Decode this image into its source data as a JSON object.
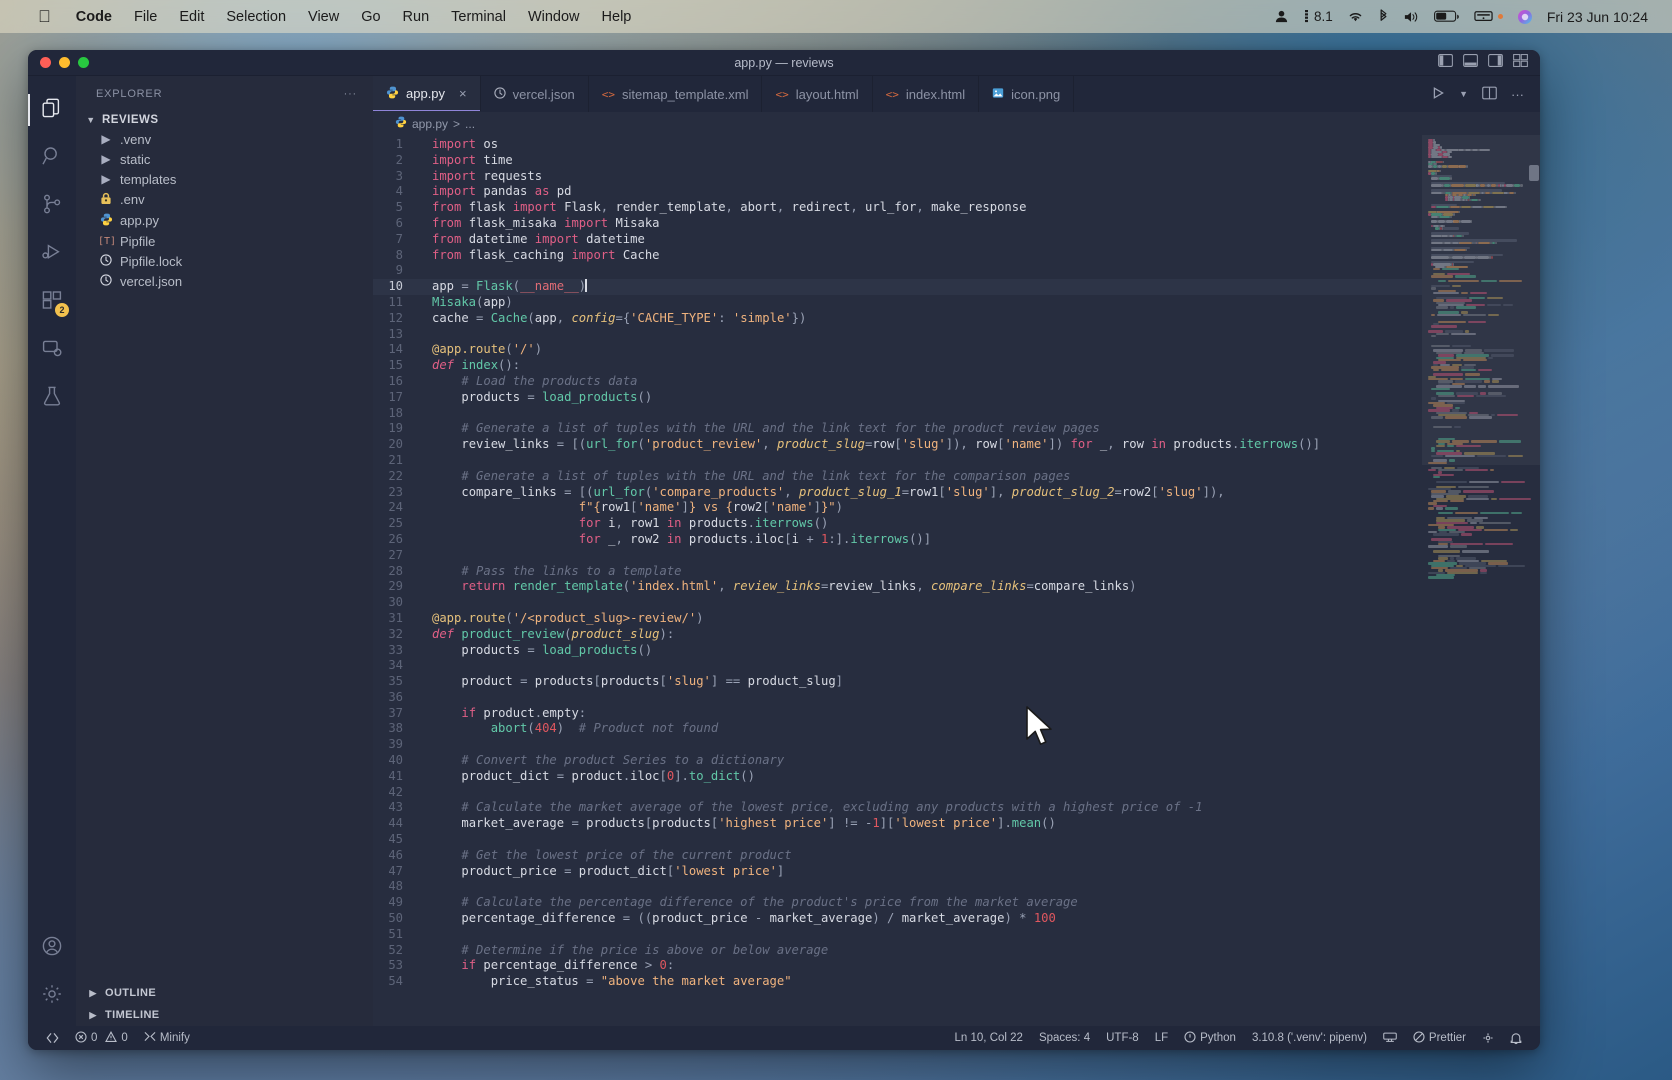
{
  "menubar": {
    "apple": "",
    "items": [
      "Code",
      "File",
      "Edit",
      "Selection",
      "View",
      "Go",
      "Run",
      "Terminal",
      "Window",
      "Help"
    ],
    "status_right": {
      "user_icon": "user-icon",
      "battery_percent": "8.1",
      "wifi_icon": "wifi-icon",
      "bluetooth_icon": "bluetooth-icon",
      "volume_icon": "volume-icon",
      "battery_icon": "battery-icon",
      "display_icon": "display-icon",
      "siri_icon": "siri-icon",
      "clock": "Fri 23 Jun 10:24"
    }
  },
  "window": {
    "title": "app.py — reviews",
    "traffic": [
      "close",
      "minimize",
      "zoom"
    ],
    "layout_buttons": [
      "toggle-primary-sidebar",
      "toggle-panel",
      "toggle-secondary-sidebar",
      "customize-layout"
    ]
  },
  "activitybar": {
    "items": [
      {
        "name": "explorer",
        "icon": "files-icon",
        "active": true,
        "badge": null
      },
      {
        "name": "search",
        "icon": "search-icon",
        "active": false,
        "badge": null
      },
      {
        "name": "source-control",
        "icon": "source-control-icon",
        "active": false,
        "badge": null
      },
      {
        "name": "run-and-debug",
        "icon": "debug-icon",
        "active": false,
        "badge": null
      },
      {
        "name": "extensions",
        "icon": "extensions-icon",
        "active": false,
        "badge": "2"
      },
      {
        "name": "remote-explorer",
        "icon": "remote-explorer-icon",
        "active": false,
        "badge": null
      },
      {
        "name": "testing",
        "icon": "beaker-icon",
        "active": false,
        "badge": null
      }
    ],
    "bottom": [
      {
        "name": "accounts",
        "icon": "account-icon"
      },
      {
        "name": "settings",
        "icon": "gear-icon"
      }
    ]
  },
  "sidebar": {
    "header": "EXPLORER",
    "more_actions": "···",
    "project": "REVIEWS",
    "files": [
      {
        "label": ".venv",
        "type": "folder",
        "icon": "folder-arrow"
      },
      {
        "label": "static",
        "type": "folder",
        "icon": "folder-arrow"
      },
      {
        "label": "templates",
        "type": "folder",
        "icon": "folder-arrow"
      },
      {
        "label": ".env",
        "type": "file",
        "icon": "lock-icon"
      },
      {
        "label": "app.py",
        "type": "file",
        "icon": "python-icon"
      },
      {
        "label": "Pipfile",
        "type": "file",
        "icon": "toml-icon"
      },
      {
        "label": "Pipfile.lock",
        "type": "file",
        "icon": "json-icon"
      },
      {
        "label": "vercel.json",
        "type": "file",
        "icon": "json-icon"
      }
    ],
    "footer": [
      {
        "label": "OUTLINE"
      },
      {
        "label": "TIMELINE"
      }
    ]
  },
  "tabs": [
    {
      "label": "app.py",
      "icon": "python-icon",
      "active": true,
      "close": "×"
    },
    {
      "label": "vercel.json",
      "icon": "json-icon",
      "active": false
    },
    {
      "label": "sitemap_template.xml",
      "icon": "code-icon",
      "active": false
    },
    {
      "label": "layout.html",
      "icon": "code-icon",
      "active": false
    },
    {
      "label": "index.html",
      "icon": "code-icon",
      "active": false
    },
    {
      "label": "icon.png",
      "icon": "image-icon",
      "active": false
    }
  ],
  "tab_actions": [
    "run-python-file",
    "chevron-down-icon",
    "split-editor-icon",
    "more-actions-icon"
  ],
  "breadcrumb": {
    "file": "app.py",
    "sep": ">",
    "rest": "..."
  },
  "editor": {
    "cursor_line": 10,
    "lines": [
      {
        "n": 1,
        "html": "<span class=\"kw\">import</span> <span class=\"var\">os</span>"
      },
      {
        "n": 2,
        "html": "<span class=\"kw\">import</span> <span class=\"var\">time</span>"
      },
      {
        "n": 3,
        "html": "<span class=\"kw\">import</span> <span class=\"var\">requests</span>"
      },
      {
        "n": 4,
        "html": "<span class=\"kw\">import</span> <span class=\"var\">pandas</span> <span class=\"kw\">as</span> <span class=\"var\">pd</span>"
      },
      {
        "n": 5,
        "html": "<span class=\"kw\">from</span> <span class=\"var\">flask</span> <span class=\"kw\">import</span> <span class=\"var\">Flask</span><span class=\"pun\">,</span> <span class=\"var\">render_template</span><span class=\"pun\">,</span> <span class=\"var\">abort</span><span class=\"pun\">,</span> <span class=\"var\">redirect</span><span class=\"pun\">,</span> <span class=\"var\">url_for</span><span class=\"pun\">,</span> <span class=\"var\">make_response</span>"
      },
      {
        "n": 6,
        "html": "<span class=\"kw\">from</span> <span class=\"var\">flask_misaka</span> <span class=\"kw\">import</span> <span class=\"var\">Misaka</span>"
      },
      {
        "n": 7,
        "html": "<span class=\"kw\">from</span> <span class=\"var\">datetime</span> <span class=\"kw\">import</span> <span class=\"var\">datetime</span>"
      },
      {
        "n": 8,
        "html": "<span class=\"kw\">from</span> <span class=\"var\">flask_caching</span> <span class=\"kw\">import</span> <span class=\"var\">Cache</span>"
      },
      {
        "n": 9,
        "html": ""
      },
      {
        "n": 10,
        "html": "<span class=\"var\">app</span> <span class=\"pun\">=</span> <span class=\"fn\">Flask</span><span class=\"pun\">(</span><span class=\"self\">__name__</span><span class=\"pun\">)</span><span class=\"caret\"></span>"
      },
      {
        "n": 11,
        "html": "<span class=\"fn\">Misaka</span><span class=\"pun\">(</span><span class=\"var\">app</span><span class=\"pun\">)</span>"
      },
      {
        "n": 12,
        "html": "<span class=\"var\">cache</span> <span class=\"pun\">=</span> <span class=\"fn\">Cache</span><span class=\"pun\">(</span><span class=\"var\">app</span><span class=\"pun\">,</span> <span class=\"italic cls\">config</span><span class=\"pun\">={</span><span class=\"str\">'CACHE_TYPE'</span><span class=\"pun\">:</span> <span class=\"str\">'simple'</span><span class=\"pun\">})</span>"
      },
      {
        "n": 13,
        "html": ""
      },
      {
        "n": 14,
        "html": "<span class=\"dec\">@app.route</span><span class=\"pun\">(</span><span class=\"str\">'/'</span><span class=\"pun\">)</span>"
      },
      {
        "n": 15,
        "html": "<span class=\"kw italic\">def</span> <span class=\"fn\">index</span><span class=\"pun\">():</span>"
      },
      {
        "n": 16,
        "html": "    <span class=\"cmt\"># Load the products data</span>"
      },
      {
        "n": 17,
        "html": "    <span class=\"var\">products</span> <span class=\"pun\">=</span> <span class=\"fn\">load_products</span><span class=\"pun\">()</span>"
      },
      {
        "n": 18,
        "html": ""
      },
      {
        "n": 19,
        "html": "    <span class=\"cmt\"># Generate a list of tuples with the URL and the link text for the product review pages</span>"
      },
      {
        "n": 20,
        "html": "    <span class=\"var\">review_links</span> <span class=\"pun\">=</span> <span class=\"pun\">[(</span><span class=\"fn\">url_for</span><span class=\"pun\">(</span><span class=\"str\">'product_review'</span><span class=\"pun\">,</span> <span class=\"italic cls\">product_slug</span><span class=\"pun\">=</span><span class=\"var\">row</span><span class=\"pun\">[</span><span class=\"str\">'slug'</span><span class=\"pun\">]),</span> <span class=\"var\">row</span><span class=\"pun\">[</span><span class=\"str\">'name'</span><span class=\"pun\">])</span> <span class=\"kw\">for</span> <span class=\"var\">_</span><span class=\"pun\">,</span> <span class=\"var\">row</span> <span class=\"kw\">in</span> <span class=\"var\">products</span><span class=\"pun\">.</span><span class=\"fn\">iterrows</span><span class=\"pun\">()]</span>"
      },
      {
        "n": 21,
        "html": ""
      },
      {
        "n": 22,
        "html": "    <span class=\"cmt\"># Generate a list of tuples with the URL and the link text for the comparison pages</span>"
      },
      {
        "n": 23,
        "html": "    <span class=\"var\">compare_links</span> <span class=\"pun\">=</span> <span class=\"pun\">[(</span><span class=\"fn\">url_for</span><span class=\"pun\">(</span><span class=\"str\">'compare_products'</span><span class=\"pun\">,</span> <span class=\"italic cls\">product_slug_1</span><span class=\"pun\">=</span><span class=\"var\">row1</span><span class=\"pun\">[</span><span class=\"str\">'slug'</span><span class=\"pun\">],</span> <span class=\"italic cls\">product_slug_2</span><span class=\"pun\">=</span><span class=\"var\">row2</span><span class=\"pun\">[</span><span class=\"str\">'slug'</span><span class=\"pun\">]),</span>"
      },
      {
        "n": 24,
        "html": "                    <span class=\"str\">f\"{</span><span class=\"var\">row1</span><span class=\"pun\">[</span><span class=\"str\">'name'</span><span class=\"pun\">]</span><span class=\"str\">} vs {</span><span class=\"var\">row2</span><span class=\"pun\">[</span><span class=\"str\">'name'</span><span class=\"pun\">]</span><span class=\"str\">}\"</span><span class=\"pun\">)</span>"
      },
      {
        "n": 25,
        "html": "                    <span class=\"kw\">for</span> <span class=\"var\">i</span><span class=\"pun\">,</span> <span class=\"var\">row1</span> <span class=\"kw\">in</span> <span class=\"var\">products</span><span class=\"pun\">.</span><span class=\"fn\">iterrows</span><span class=\"pun\">()</span>"
      },
      {
        "n": 26,
        "html": "                    <span class=\"kw\">for</span> <span class=\"var\">_</span><span class=\"pun\">,</span> <span class=\"var\">row2</span> <span class=\"kw\">in</span> <span class=\"var\">products</span><span class=\"pun\">.</span><span class=\"var\">iloc</span><span class=\"pun\">[</span><span class=\"var\">i</span> <span class=\"pun\">+</span> <span class=\"num\">1</span><span class=\"pun\">:].</span><span class=\"fn\">iterrows</span><span class=\"pun\">()]</span>"
      },
      {
        "n": 27,
        "html": ""
      },
      {
        "n": 28,
        "html": "    <span class=\"cmt\"># Pass the links to a template</span>"
      },
      {
        "n": 29,
        "html": "    <span class=\"kw\">return</span> <span class=\"fn\">render_template</span><span class=\"pun\">(</span><span class=\"str\">'index.html'</span><span class=\"pun\">,</span> <span class=\"italic cls\">review_links</span><span class=\"pun\">=</span><span class=\"var\">review_links</span><span class=\"pun\">,</span> <span class=\"italic cls\">compare_links</span><span class=\"pun\">=</span><span class=\"var\">compare_links</span><span class=\"pun\">)</span>"
      },
      {
        "n": 30,
        "html": ""
      },
      {
        "n": 31,
        "html": "<span class=\"dec\">@app.route</span><span class=\"pun\">(</span><span class=\"str\">'/&lt;product_slug&gt;-review/'</span><span class=\"pun\">)</span>"
      },
      {
        "n": 32,
        "html": "<span class=\"kw italic\">def</span> <span class=\"fn\">product_review</span><span class=\"pun\">(</span><span class=\"italic cls\">product_slug</span><span class=\"pun\">):</span>"
      },
      {
        "n": 33,
        "html": "    <span class=\"var\">products</span> <span class=\"pun\">=</span> <span class=\"fn\">load_products</span><span class=\"pun\">()</span>"
      },
      {
        "n": 34,
        "html": ""
      },
      {
        "n": 35,
        "html": "    <span class=\"var\">product</span> <span class=\"pun\">=</span> <span class=\"var\">products</span><span class=\"pun\">[</span><span class=\"var\">products</span><span class=\"pun\">[</span><span class=\"str\">'slug'</span><span class=\"pun\">]</span> <span class=\"pun\">==</span> <span class=\"var\">product_slug</span><span class=\"pun\">]</span>"
      },
      {
        "n": 36,
        "html": ""
      },
      {
        "n": 37,
        "html": "    <span class=\"kw\">if</span> <span class=\"var\">product</span><span class=\"pun\">.</span><span class=\"var\">empty</span><span class=\"pun\">:</span>"
      },
      {
        "n": 38,
        "html": "        <span class=\"fn\">abort</span><span class=\"pun\">(</span><span class=\"num\">404</span><span class=\"pun\">)</span>  <span class=\"cmt\"># Product not found</span>"
      },
      {
        "n": 39,
        "html": ""
      },
      {
        "n": 40,
        "html": "    <span class=\"cmt\"># Convert the product Series to a dictionary</span>"
      },
      {
        "n": 41,
        "html": "    <span class=\"var\">product_dict</span> <span class=\"pun\">=</span> <span class=\"var\">product</span><span class=\"pun\">.</span><span class=\"var\">iloc</span><span class=\"pun\">[</span><span class=\"num\">0</span><span class=\"pun\">].</span><span class=\"fn\">to_dict</span><span class=\"pun\">()</span>"
      },
      {
        "n": 42,
        "html": ""
      },
      {
        "n": 43,
        "html": "    <span class=\"cmt\"># Calculate the market average of the lowest price, excluding any products with a highest price of -1</span>"
      },
      {
        "n": 44,
        "html": "    <span class=\"var\">market_average</span> <span class=\"pun\">=</span> <span class=\"var\">products</span><span class=\"pun\">[</span><span class=\"var\">products</span><span class=\"pun\">[</span><span class=\"str\">'highest price'</span><span class=\"pun\">]</span> <span class=\"pun\">!=</span> <span class=\"pun\">-</span><span class=\"num\">1</span><span class=\"pun\">][</span><span class=\"str\">'lowest price'</span><span class=\"pun\">].</span><span class=\"fn\">mean</span><span class=\"pun\">()</span>"
      },
      {
        "n": 45,
        "html": ""
      },
      {
        "n": 46,
        "html": "    <span class=\"cmt\"># Get the lowest price of the current product</span>"
      },
      {
        "n": 47,
        "html": "    <span class=\"var\">product_price</span> <span class=\"pun\">=</span> <span class=\"var\">product_dict</span><span class=\"pun\">[</span><span class=\"str\">'lowest price'</span><span class=\"pun\">]</span>"
      },
      {
        "n": 48,
        "html": ""
      },
      {
        "n": 49,
        "html": "    <span class=\"cmt\"># Calculate the percentage difference of the product's price from the market average</span>"
      },
      {
        "n": 50,
        "html": "    <span class=\"var\">percentage_difference</span> <span class=\"pun\">=</span> <span class=\"pun\">((</span><span class=\"var\">product_price</span> <span class=\"pun\">-</span> <span class=\"var\">market_average</span><span class=\"pun\">)</span> <span class=\"pun\">/</span> <span class=\"var\">market_average</span><span class=\"pun\">)</span> <span class=\"pun\">*</span> <span class=\"num\">100</span>"
      },
      {
        "n": 51,
        "html": ""
      },
      {
        "n": 52,
        "html": "    <span class=\"cmt\"># Determine if the price is above or below average</span>"
      },
      {
        "n": 53,
        "html": "    <span class=\"kw\">if</span> <span class=\"var\">percentage_difference</span> <span class=\"pun\">&gt;</span> <span class=\"num\">0</span><span class=\"pun\">:</span>"
      },
      {
        "n": 54,
        "html": "        <span class=\"var\">price_status</span> <span class=\"pun\">=</span> <span class=\"str\">\"above the market average\"</span>"
      }
    ]
  },
  "statusbar": {
    "remote_icon": "remote-indicator-icon",
    "errors": "0",
    "warnings": "0",
    "minify": "Minify",
    "position": "Ln 10, Col 22",
    "spaces": "Spaces: 4",
    "encoding": "UTF-8",
    "eol": "LF",
    "language": "Python",
    "interpreter": "3.10.8 ('.venv': pipenv)",
    "prettier": "Prettier",
    "bell_icon": "bell-icon"
  },
  "colors": {
    "accent": "#8f84d8",
    "badge": "#f2c14e",
    "editor_bg": "#272d3f",
    "sidebar_bg": "#262b3c",
    "chrome_bg": "#21273a"
  }
}
